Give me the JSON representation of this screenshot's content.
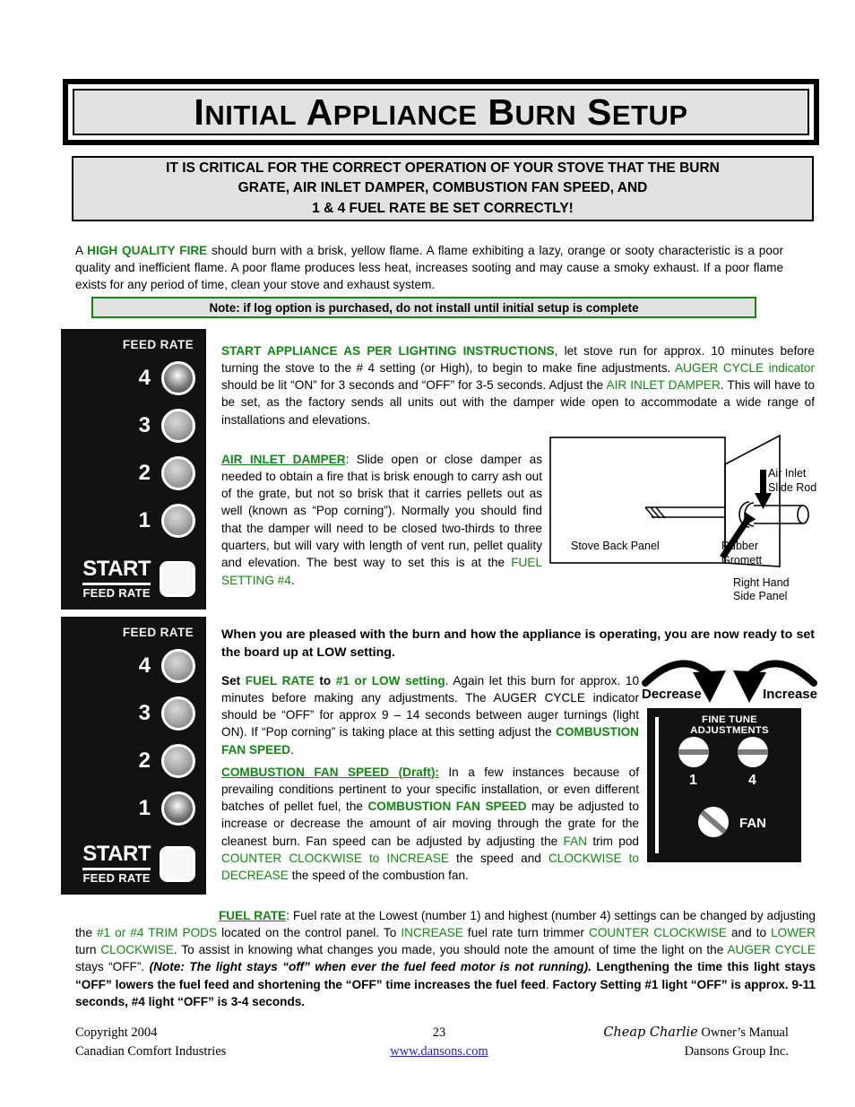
{
  "header": {
    "title_words": [
      "Initial",
      "Appliance",
      "Burn",
      "Setup"
    ],
    "title_plain": "INITIAL APPLIANCE BURN SETUP"
  },
  "critical_notice": {
    "line1": "IT IS CRITICAL FOR THE CORRECT OPERATION OF YOUR STOVE THAT THE BURN",
    "line2": "GRATE, AIR INLET DAMPER, COMBUSTION FAN SPEED, AND",
    "line3": "1 & 4 FUEL RATE BE SET CORRECTLY!"
  },
  "intro": {
    "t1": "A ",
    "highlight": "HIGH QUALITY FIRE",
    "t2": " should burn with a brisk, yellow flame.  A flame exhibiting a lazy, orange or sooty characteristic is a poor quality and inefficient flame.  A poor flame produces less heat, increases sooting and may cause a smoky exhaust.  If a poor flame exists for any period of time, clean your stove and exhaust system."
  },
  "note_box": {
    "text": "Note: if log option is purchased, do not install until initial setup is complete"
  },
  "panel_top": {
    "heading": "FEED RATE",
    "leds": [
      {
        "number": "4",
        "state": "on"
      },
      {
        "number": "3",
        "state": "off"
      },
      {
        "number": "2",
        "state": "off"
      },
      {
        "number": "1",
        "state": "off"
      }
    ],
    "start_word": "START",
    "start_sub": "FEED RATE"
  },
  "panel_bottom": {
    "heading": "FEED RATE",
    "leds": [
      {
        "number": "4",
        "state": "off"
      },
      {
        "number": "3",
        "state": "off"
      },
      {
        "number": "2",
        "state": "off"
      },
      {
        "number": "1",
        "state": "on"
      }
    ],
    "start_word": "START",
    "start_sub": "FEED RATE"
  },
  "block_start": {
    "heading": "START APPLIANCE AS PER LIGHTING INSTRUCTIONS",
    "t1": ", let stove run for approx. 10 minutes before turning the stove to the # 4 setting (or High), to begin to make fine adjustments.  ",
    "g1": "AUGER CYCLE indicator",
    "t2": " should be lit “ON” for 3 seconds and  “OFF” for 3-5 seconds. Adjust the ",
    "g2": "AIR INLET DAMPER",
    "t3": ". This will have to be set, as the factory sends all units out with the damper wide open to accommodate a wide range of installations and elevations."
  },
  "block_damper": {
    "heading": "AIR INLET DAMPER",
    "t1": ":   Slide open or close damper as needed to obtain a fire that is brisk enough to carry ash out of the grate, but not so brisk that it carries pellets out as well (known as “Pop corning”). Normally you should find that the damper will need to be closed two-thirds to three quarters, but will vary with length of vent run, pellet quality and elevation. The best way to set this is at the ",
    "g1": "FUEL SETTING #4",
    "t2": "."
  },
  "diagram": {
    "label_air_inlet": "Air Inlet",
    "label_slide_rod": "Slide Rod",
    "label_rubber": "Rubber",
    "label_grommet": "Gromett",
    "label_back_panel": "Stove Back Panel",
    "label_right_hand": "Right Hand",
    "label_side_panel": "Side Panel"
  },
  "block_low": {
    "text": "When you are pleased with the burn and how the appliance is operating,  you are now ready to set the board up at LOW setting."
  },
  "block_set": {
    "t1": "Set ",
    "g1": "FUEL RATE",
    "t2": " to ",
    "g2": "#1 or LOW setting",
    "t3": ".  Again let this burn for approx. 10 minutes before making any adjustments. The AUGER CYCLE indicator should be “OFF” for approx 9 – 14 seconds between auger turnings (light ON). If “Pop corning” is taking place at this setting adjust the ",
    "g3": "COMBUSTION FAN SPEED",
    "t4": "."
  },
  "block_fan": {
    "heading": "COMBUSTION FAN SPEED (Draft):",
    "t1": " In a few instances because of prevailing conditions pertinent to your specific installation, or even different batches of pellet fuel, the ",
    "g1": "COMBUSTION FAN SPEED",
    "t2": " may be adjusted to increase or decrease the amount of air moving through the grate for the cleanest burn. Fan speed can be adjusted by adjusting the ",
    "g2": "FAN",
    "t3": " trim pod ",
    "g3": "COUNTER CLOCKWISE to INCREASE",
    "t4": " the speed and ",
    "g4": "CLOCKWISE to DECREASE",
    "t5": " the speed of the combustion fan."
  },
  "adjust_arrows": {
    "decrease": "Decrease",
    "increase": "Increase"
  },
  "fine_panel": {
    "title": "FINE TUNE ADJUSTMENTS",
    "pods": [
      {
        "name": "1",
        "label": "1"
      },
      {
        "name": "4",
        "label": "4"
      },
      {
        "name": "fan",
        "label": "FAN"
      }
    ]
  },
  "block_fuel": {
    "heading": "FUEL RATE",
    "t1": ": Fuel rate at the Lowest (number 1) and highest (number 4) settings can be changed by adjusting the ",
    "g1": "#1 or #4 TRIM PODS",
    "t2": " located on the control panel.  To ",
    "g2": "INCREASE",
    "t3": " fuel rate turn trimmer ",
    "g3": "COUNTER CLOCKWISE",
    "t4": " and to ",
    "g4": "LOWER",
    "t5": " turn ",
    "g5": "CLOCKWISE",
    "t6": ". To assist in knowing what changes you made, you should note the amount of time the light on the ",
    "g6": "AUGER CYCLE",
    "t7": " stays “OFF”. ",
    "i1": "(Note: The light stays “off” when ever the fuel feed motor is not running).",
    "b1": " Lengthening the time this light stays “OFF” lowers the fuel feed and shortening the “OFF” time increases the fuel feed",
    "t8": ". ",
    "b2": "Factory Setting #1 light “OFF” is approx. 9-11 seconds, #4 light “OFF” is 3-4 seconds."
  },
  "footer": {
    "copyright": "Copyright 2004",
    "company": "Canadian Comfort Industries",
    "page_number": "23",
    "website": "www.dansons.com",
    "manual_brand": "Cheap Charlie",
    "manual_suffix": " Owner’s Manual",
    "group": "Dansons Group Inc."
  },
  "colors": {
    "green": "#118811",
    "panel_black": "#121212",
    "box_gray": "#e2e2e2",
    "link_blue": "#2222cc"
  }
}
